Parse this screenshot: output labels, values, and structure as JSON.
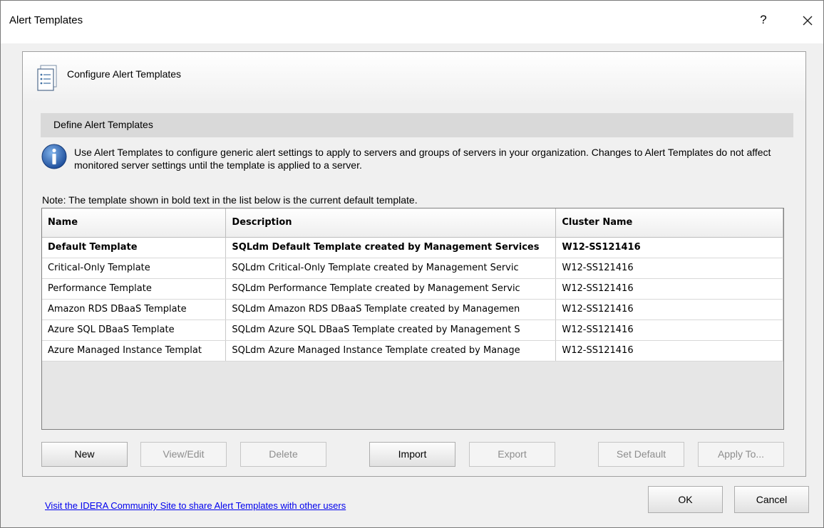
{
  "window": {
    "title": "Alert Templates",
    "help_label": "?"
  },
  "header": {
    "title": "Configure Alert Templates",
    "icon": "document-list-icon"
  },
  "section": {
    "title": "Define Alert Templates"
  },
  "info": {
    "icon": "info-icon",
    "text": "Use Alert Templates to configure generic alert settings to apply to servers and groups of servers in your organization.  Changes to Alert Templates do not affect monitored server settings until the template is applied to a server."
  },
  "note": "Note:  The template shown in bold text in the list below is the current default template.",
  "table": {
    "columns": [
      "Name",
      "Description",
      "Cluster Name"
    ],
    "rows": [
      {
        "name": "Default Template",
        "description": "SQLdm Default Template created by Management Services",
        "cluster": "W12-SS121416",
        "bold": true
      },
      {
        "name": "Critical-Only Template",
        "description": "SQLdm Critical-Only Template created by Management Servic",
        "cluster": "W12-SS121416",
        "bold": false
      },
      {
        "name": "Performance Template",
        "description": "SQLdm Performance Template created by Management Servic",
        "cluster": "W12-SS121416",
        "bold": false
      },
      {
        "name": "Amazon RDS DBaaS Template",
        "description": "SQLdm Amazon RDS DBaaS Template created by Managemen",
        "cluster": "W12-SS121416",
        "bold": false
      },
      {
        "name": "Azure SQL DBaaS Template",
        "description": "SQLdm Azure SQL DBaaS Template created by Management S",
        "cluster": "W12-SS121416",
        "bold": false
      },
      {
        "name": "Azure Managed Instance Templat",
        "description": "SQLdm Azure Managed Instance Template created by Manage",
        "cluster": "W12-SS121416",
        "bold": false
      }
    ]
  },
  "buttons": {
    "new": "New",
    "view_edit": "View/Edit",
    "delete": "Delete",
    "import": "Import",
    "export": "Export",
    "set_default": "Set Default",
    "apply_to": "Apply To..."
  },
  "footer": {
    "link": "Visit the IDERA Community Site to share Alert Templates with other users",
    "ok": "OK",
    "cancel": "Cancel"
  }
}
